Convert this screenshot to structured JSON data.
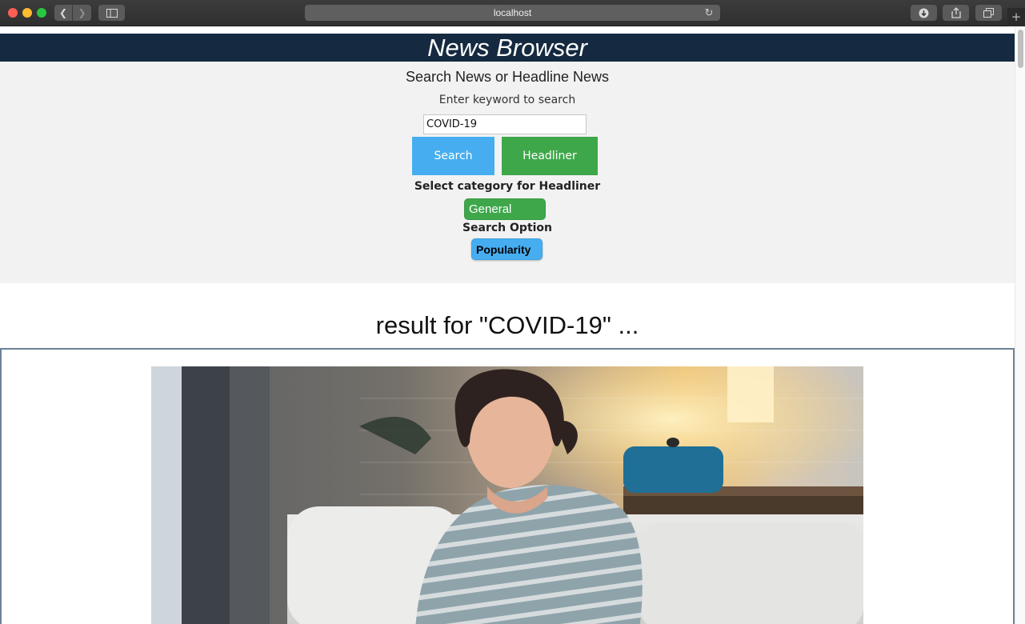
{
  "browser": {
    "url": "localhost",
    "icons": {
      "back": "chevron-left-icon",
      "forward": "chevron-right-icon",
      "sidebar": "sidebar-icon",
      "reload": "reload-icon",
      "download": "download-icon",
      "share": "share-icon",
      "tabs": "tabs-icon",
      "new_tab": "plus-icon"
    }
  },
  "header": {
    "title": "News Browser"
  },
  "search_panel": {
    "subtitle": "Search News or Headline News",
    "hint": "Enter keyword to search",
    "input_value": "COVID-19",
    "search_button": "Search",
    "headliner_button": "Headliner",
    "category_label": "Select category for Headliner",
    "category_selected": "General",
    "option_label": "Search Option",
    "option_selected": "Popularity"
  },
  "results": {
    "title": "result for \"COVID-19\" ..."
  },
  "colors": {
    "header_bg": "#152a40",
    "panel_bg": "#f2f2f2",
    "search_blue": "#46aef0",
    "headliner_green": "#3ea74a",
    "card_border": "#6d8296"
  }
}
